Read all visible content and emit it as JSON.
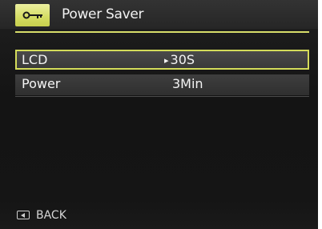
{
  "header": {
    "title": "Power Saver",
    "icon": "key-icon",
    "accent_color": "#d4dc5a"
  },
  "settings": [
    {
      "label": "LCD",
      "value": "30S",
      "selected": true,
      "indicator": "▸"
    },
    {
      "label": "Power",
      "value": "3Min",
      "selected": false
    }
  ],
  "footer": {
    "back_label": "BACK",
    "back_icon": "back-button-icon"
  }
}
